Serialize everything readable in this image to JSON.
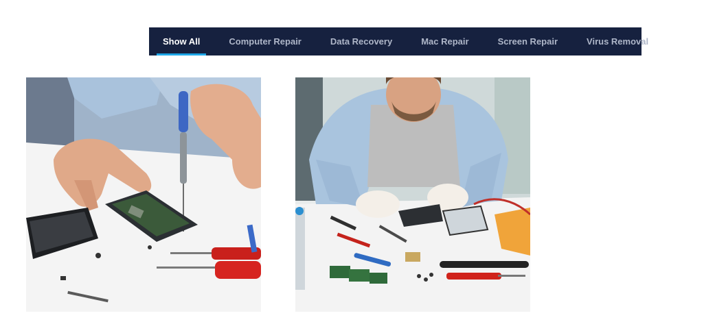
{
  "filters": {
    "tabs": [
      {
        "label": "Show All",
        "active": true
      },
      {
        "label": "Computer Repair",
        "active": false
      },
      {
        "label": "Data Recovery",
        "active": false
      },
      {
        "label": "Mac Repair",
        "active": false
      },
      {
        "label": "Screen Repair",
        "active": false
      },
      {
        "label": "Virus Removal",
        "active": false
      }
    ]
  },
  "colors": {
    "bar_background": "#16213f",
    "active_underline": "#1ea7e8",
    "inactive_text": "#aeb6c8",
    "active_text": "#ffffff"
  },
  "gallery": [
    {
      "image": "phone-repair-photo"
    },
    {
      "image": "technician-repair-photo"
    }
  ]
}
